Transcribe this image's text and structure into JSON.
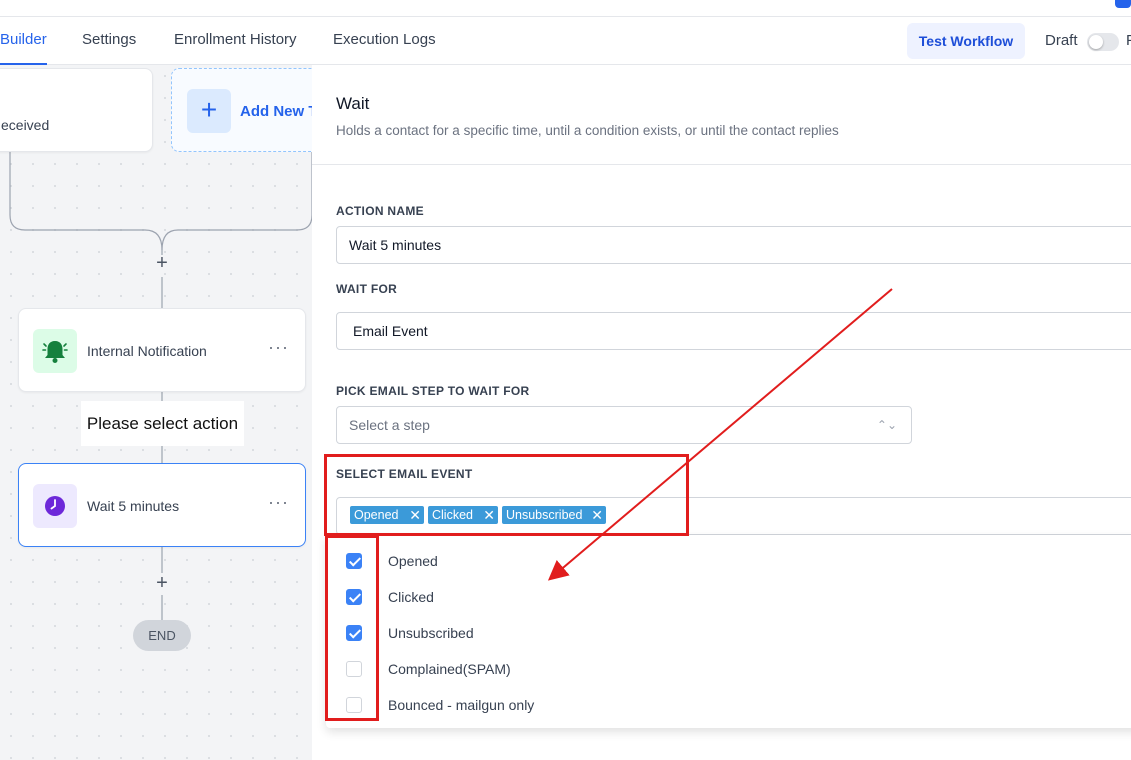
{
  "nav": {
    "tabs": [
      "Builder",
      "Settings",
      "Enrollment History",
      "Execution Logs"
    ],
    "test_workflow": "Test Workflow",
    "draft": "Draft",
    "publish_peek": "P"
  },
  "canvas": {
    "trigger_label": "eceived",
    "add_trigger": "Add New T",
    "plus": "+",
    "notification_label": "Internal Notification",
    "wait_label": "Wait 5 minutes",
    "dots": "···",
    "tooltip": "Please select action",
    "end": "END"
  },
  "panel": {
    "title": "Wait",
    "subtitle": "Holds a contact for a specific time, until a condition exists, or until the contact replies",
    "action_name_label": "ACTION NAME",
    "action_name_value": "Wait 5 minutes",
    "wait_for_label": "WAIT FOR",
    "wait_for_value": "Email Event",
    "pick_step_label": "PICK EMAIL STEP TO WAIT FOR",
    "pick_step_placeholder": "Select a step",
    "select_event_label": "SELECT EMAIL EVENT",
    "selected_tags": [
      "Opened",
      "Clicked",
      "Unsubscribed"
    ],
    "tag_remove": "✕",
    "options": [
      {
        "label": "Opened",
        "checked": true
      },
      {
        "label": "Clicked",
        "checked": true
      },
      {
        "label": "Unsubscribed",
        "checked": true
      },
      {
        "label": "Complained(SPAM)",
        "checked": false
      },
      {
        "label": "Bounced - mailgun only",
        "checked": false
      }
    ]
  },
  "colors": {
    "accent": "#2563eb",
    "annotation_red": "#e11d1d",
    "tag_blue": "#3b9ad9"
  }
}
